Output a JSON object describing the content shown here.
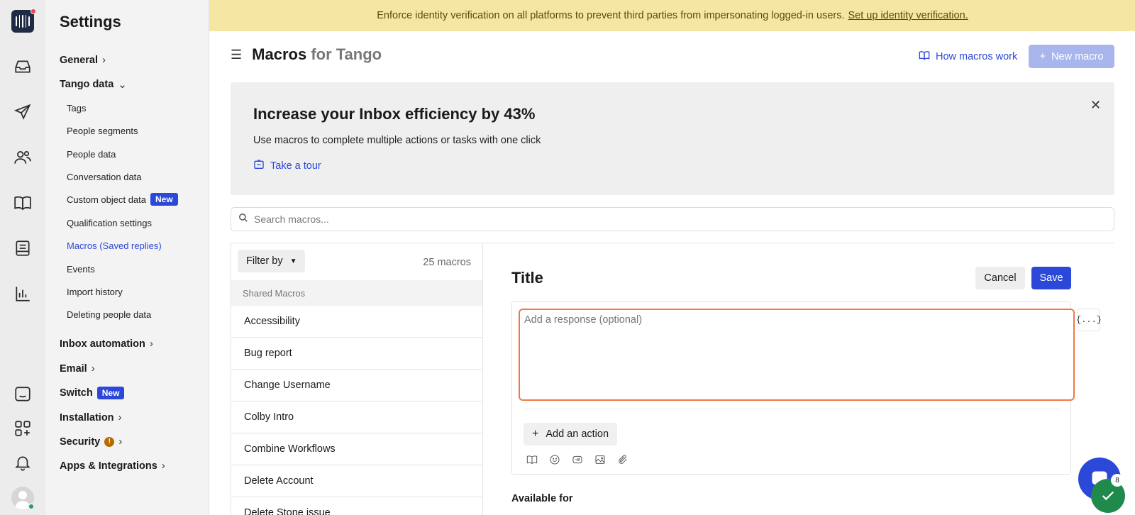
{
  "rail": {
    "icons": [
      "logo-icon",
      "inbox-icon",
      "outbound-icon",
      "contacts-icon",
      "knowledge-icon",
      "reports-panel-icon",
      "chart-icon",
      "messenger-icon",
      "apps-icon",
      "notifications-icon"
    ]
  },
  "settings_nav": {
    "title": "Settings",
    "groups": [
      {
        "label": "General"
      },
      {
        "label": "Tango data"
      },
      {
        "label": "Inbox automation"
      },
      {
        "label": "Email"
      },
      {
        "label": "Switch",
        "badge": "New"
      },
      {
        "label": "Installation"
      },
      {
        "label": "Security"
      },
      {
        "label": "Apps & Integrations"
      }
    ],
    "tango_items": [
      {
        "label": "Tags"
      },
      {
        "label": "People segments"
      },
      {
        "label": "People data"
      },
      {
        "label": "Conversation data"
      },
      {
        "label": "Custom object data",
        "badge": "New"
      },
      {
        "label": "Qualification settings"
      },
      {
        "label": "Macros (Saved replies)",
        "active": true
      },
      {
        "label": "Events"
      },
      {
        "label": "Import history"
      },
      {
        "label": "Deleting people data"
      }
    ],
    "security_warning": "!"
  },
  "banner": {
    "text": "Enforce identity verification on all platforms to prevent third parties from impersonating logged-in users.",
    "link": "Set up identity verification."
  },
  "header": {
    "title": "Macros",
    "subtitle": "for Tango",
    "how_link": "How macros work",
    "new_macro": "New macro"
  },
  "promo": {
    "title": "Increase your Inbox efficiency by 43%",
    "description": "Use macros to complete multiple actions or tasks with one click",
    "tour_link": "Take a tour"
  },
  "search": {
    "placeholder": "Search macros..."
  },
  "macro_list": {
    "filter_label": "Filter by",
    "count": "25 macros",
    "group_header": "Shared Macros",
    "items": [
      "Accessibility",
      "Bug report",
      "Change Username",
      "Colby Intro",
      "Combine Workflows",
      "Delete Account",
      "Delete Stone issue"
    ]
  },
  "editor": {
    "title": "Title",
    "cancel": "Cancel",
    "save": "Save",
    "response_placeholder": "Add a response (optional)",
    "variable_button": "{...}",
    "add_action": "Add an action",
    "available_for": "Available for"
  },
  "launcher": {
    "badge": "8"
  },
  "colors": {
    "accent": "#2c48d8",
    "banner_bg": "#f6e6a4",
    "focus_border": "#ee7a45",
    "success": "#1f8a4c"
  }
}
